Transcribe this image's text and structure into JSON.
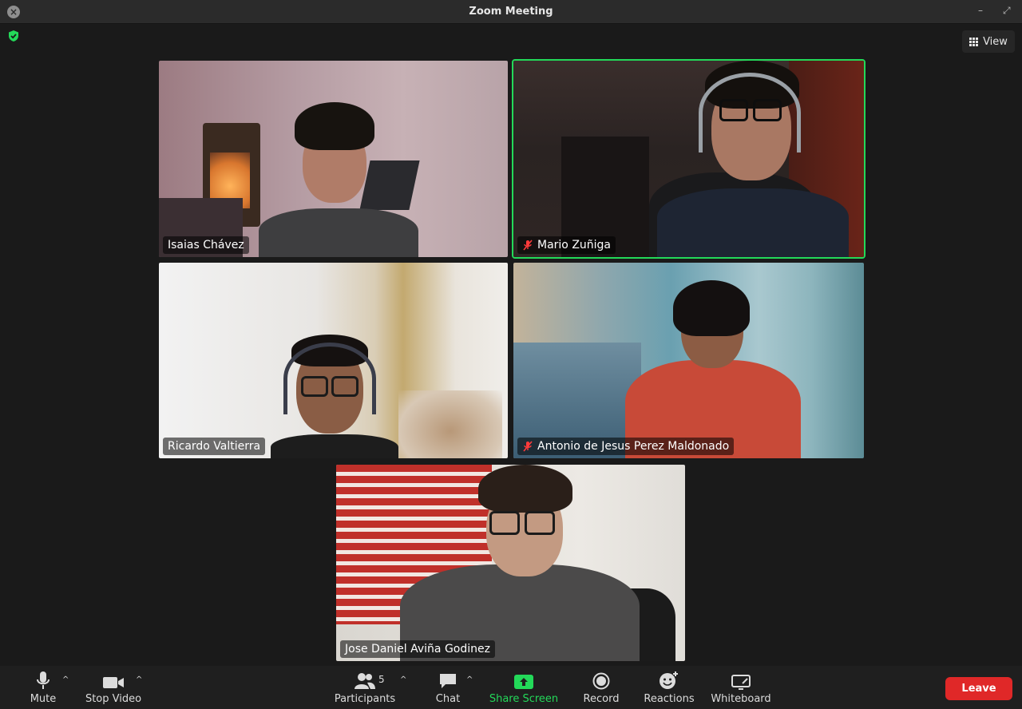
{
  "window": {
    "title": "Zoom Meeting"
  },
  "top_bar": {
    "view_label": "View"
  },
  "participants": [
    {
      "name": "Isaias Chávez",
      "muted": false
    },
    {
      "name": "Mario Zuñiga",
      "muted": true,
      "active_speaker": true
    },
    {
      "name": "Ricardo Valtierra",
      "muted": false
    },
    {
      "name": "Antonio de Jesus Perez Maldonado",
      "muted": true
    },
    {
      "name": "Jose Daniel Aviña Godinez",
      "muted": false
    }
  ],
  "toolbar": {
    "mute_label": "Mute",
    "video_label": "Stop Video",
    "participants_label": "Participants",
    "participants_count": "5",
    "chat_label": "Chat",
    "share_label": "Share Screen",
    "record_label": "Record",
    "reactions_label": "Reactions",
    "whiteboard_label": "Whiteboard",
    "leave_label": "Leave"
  },
  "colors": {
    "accent_green": "#23d959",
    "leave_red": "#e02828",
    "background": "#1a1a1a"
  },
  "icons": [
    "close-icon",
    "minimize-icon",
    "maximize-icon",
    "shield-icon",
    "grid-icon",
    "microphone-icon",
    "video-camera-icon",
    "participants-icon",
    "chat-icon",
    "share-screen-icon",
    "record-icon",
    "reactions-icon",
    "whiteboard-icon",
    "muted-mic-icon"
  ]
}
